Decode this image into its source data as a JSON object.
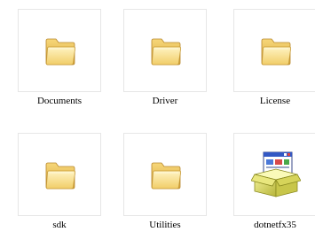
{
  "view_mode": "thumbnails",
  "items": [
    {
      "label": "Documents",
      "icon": "folder-icon",
      "type": "folder"
    },
    {
      "label": "Driver",
      "icon": "folder-icon",
      "type": "folder"
    },
    {
      "label": "License",
      "icon": "folder-icon",
      "type": "folder"
    },
    {
      "label": "sdk",
      "icon": "folder-icon",
      "type": "folder"
    },
    {
      "label": "Utilities",
      "icon": "folder-icon",
      "type": "folder"
    },
    {
      "label": "dotnetfx35",
      "icon": "installer-icon",
      "type": "application"
    }
  ],
  "colors": {
    "background": "#ffffff",
    "thumb_border": "#e6e6e6",
    "folder_light": "#fbe89c",
    "folder_dark": "#d9a93a"
  }
}
